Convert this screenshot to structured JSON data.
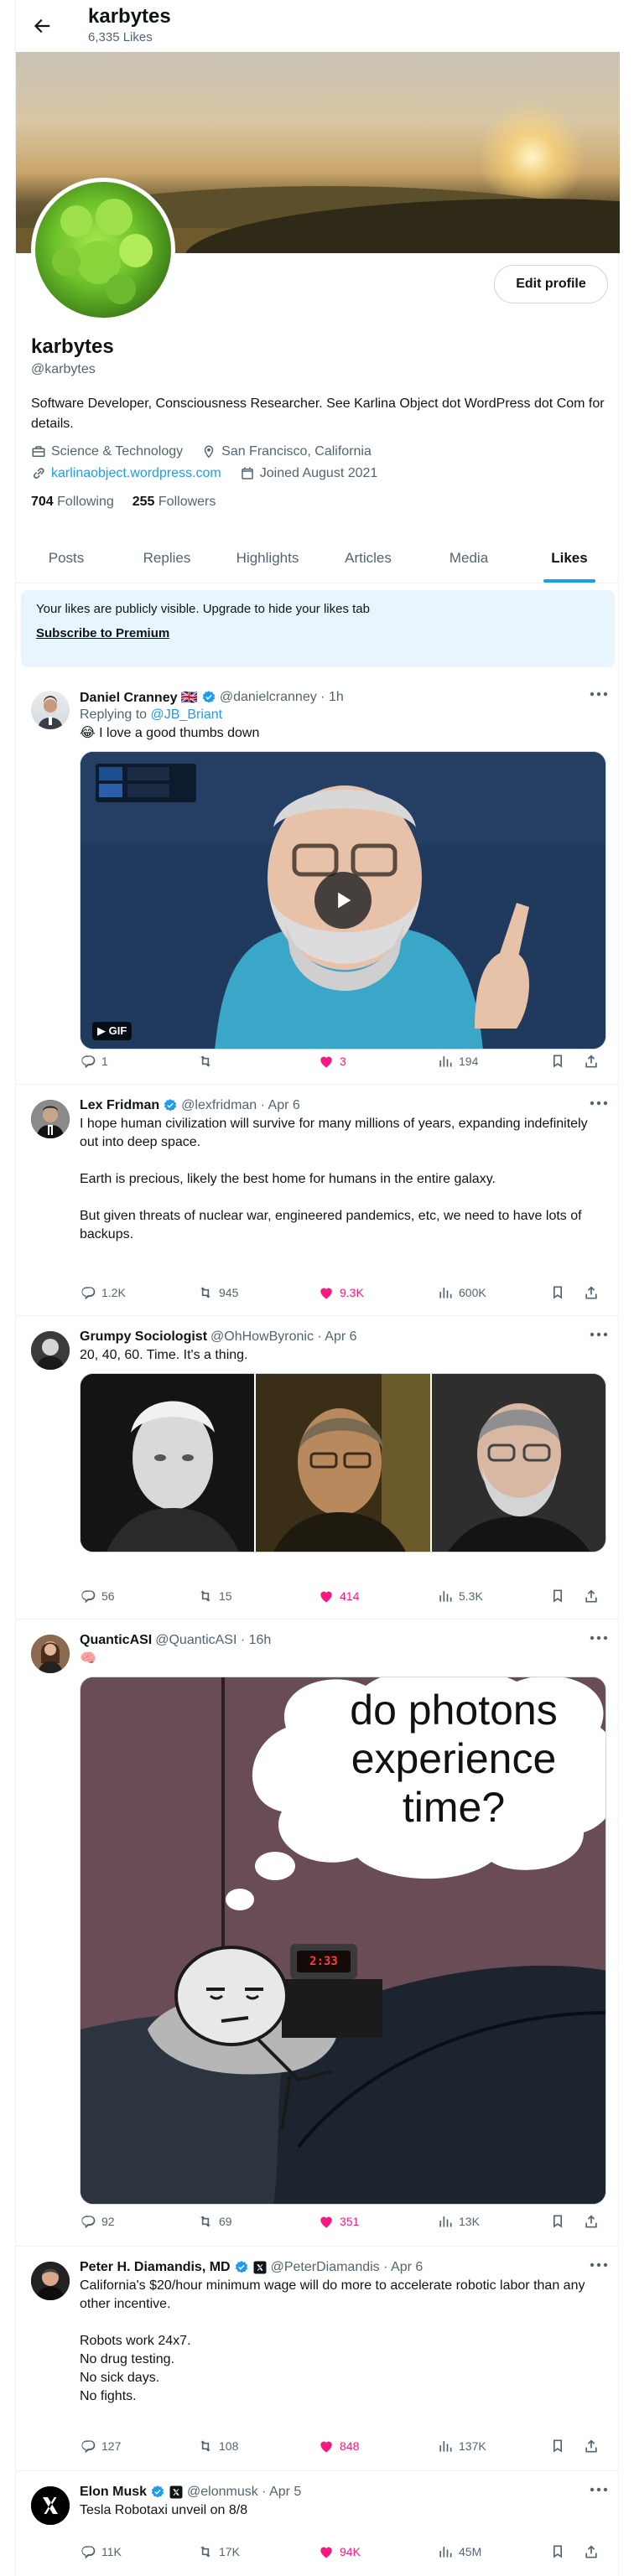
{
  "header": {
    "name": "karbytes",
    "likes_count": "6,335 Likes"
  },
  "profile": {
    "display_name": "karbytes",
    "handle": "@karbytes",
    "edit_label": "Edit profile",
    "bio": "Software Developer, Consciousness Researcher. See Karlina Object dot WordPress dot Com for details.",
    "category": "Science & Technology",
    "location": "San Francisco, California",
    "website": "karlinaobject.wordpress.com",
    "joined": "Joined August 2021",
    "following_count": "704",
    "following_label": "Following",
    "followers_count": "255",
    "followers_label": "Followers"
  },
  "tabs": [
    {
      "label": "Posts"
    },
    {
      "label": "Replies"
    },
    {
      "label": "Highlights"
    },
    {
      "label": "Articles"
    },
    {
      "label": "Media"
    },
    {
      "label": "Likes"
    }
  ],
  "notice": {
    "text": "Your likes are publicly visible. Upgrade to hide your likes tab",
    "link": "Subscribe to Premium"
  },
  "tweets": [
    {
      "name": "Daniel Cranney 🇬🇧",
      "handle": "@danielcranney · 1h",
      "reply_prefix": "Replying to",
      "reply_to": "@JB_Briant",
      "text": "😂 I love a good thumbs down",
      "gif_label": "GIF",
      "replies": "1",
      "reposts": "",
      "likes": "3",
      "views": "194"
    },
    {
      "name": "Lex Fridman",
      "handle": "@lexfridman · Apr 6",
      "text": "I hope human civilization will survive for many millions of years, expanding indefinitely out into deep space.\n\nEarth is precious, likely the best home for humans in the entire galaxy.\n\nBut given threats of nuclear war, engineered pandemics, etc, we need to have lots of backups.",
      "replies": "1.2K",
      "reposts": "945",
      "likes": "9.3K",
      "views": "600K"
    },
    {
      "name": "Grumpy Sociologist",
      "handle": "@OhHowByronic · Apr 6",
      "text": "20, 40, 60. Time. It's a thing.",
      "replies": "56",
      "reposts": "15",
      "likes": "414",
      "views": "5.3K"
    },
    {
      "name": "QuanticASI",
      "handle": "@QuanticASI · 16h",
      "text": "🧠",
      "image_caption": "do photons experience time?",
      "clock": "2:33",
      "replies": "92",
      "reposts": "69",
      "likes": "351",
      "views": "13K"
    },
    {
      "name": "Peter H. Diamandis, MD",
      "handle": "@PeterDiamandis · Apr 6",
      "text": "California's $20/hour minimum wage will do more to accelerate robotic labor than any other incentive.\n\nRobots work 24x7.\nNo drug testing.\nNo sick days.\nNo fights.",
      "replies": "127",
      "reposts": "108",
      "likes": "848",
      "views": "137K"
    },
    {
      "name": "Elon Musk",
      "handle": "@elonmusk · Apr 5",
      "text": "Tesla Robotaxi unveil on 8/8",
      "replies": "11K",
      "reposts": "17K",
      "likes": "94K",
      "views": "45M"
    }
  ],
  "colors": {
    "accent": "#1d9bf0",
    "like": "#f91880",
    "muted": "#536471",
    "text": "#0f1419"
  }
}
